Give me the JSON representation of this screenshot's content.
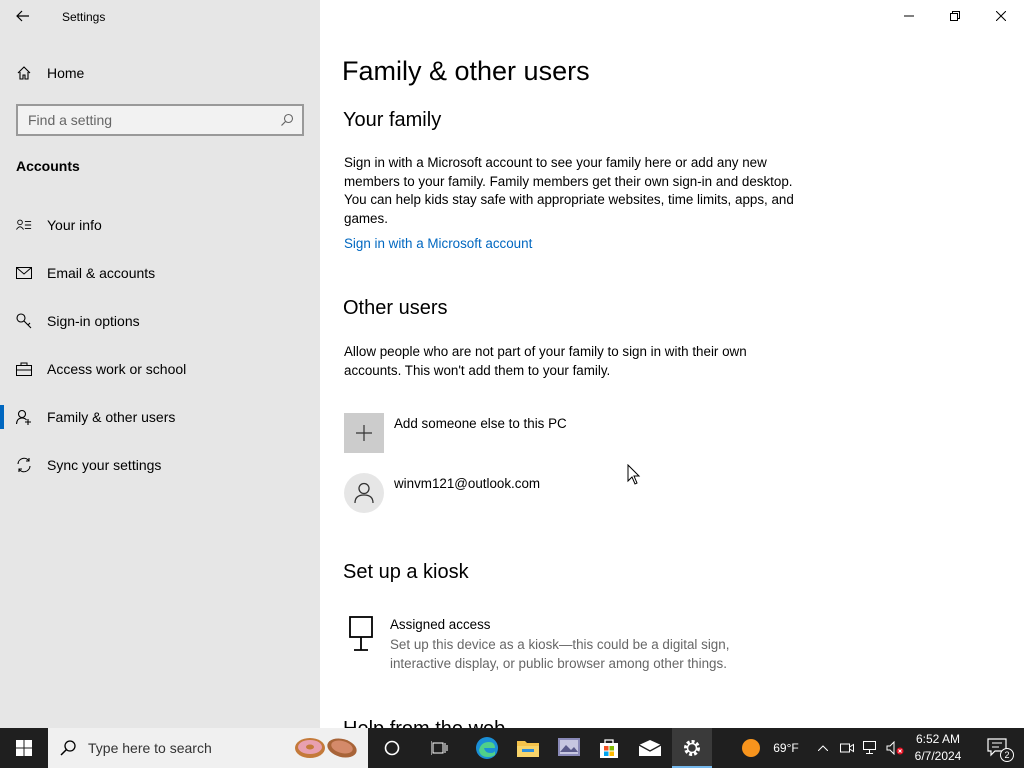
{
  "window": {
    "app_title": "Settings",
    "controls": [
      "minimize",
      "restore",
      "close"
    ]
  },
  "sidebar": {
    "home_label": "Home",
    "search_placeholder": "Find a setting",
    "section_title": "Accounts",
    "items": [
      {
        "label": "Your info",
        "icon": "person-card-icon",
        "active": false
      },
      {
        "label": "Email & accounts",
        "icon": "mail-icon",
        "active": false
      },
      {
        "label": "Sign-in options",
        "icon": "key-icon",
        "active": false
      },
      {
        "label": "Access work or school",
        "icon": "briefcase-icon",
        "active": false
      },
      {
        "label": "Family & other users",
        "icon": "person-add-icon",
        "active": true
      },
      {
        "label": "Sync your settings",
        "icon": "sync-icon",
        "active": false
      }
    ]
  },
  "main": {
    "page_title": "Family & other users",
    "family": {
      "heading": "Your family",
      "description": "Sign in with a Microsoft account to see your family here or add any new members to your family. Family members get their own sign-in and desktop. You can help kids stay safe with appropriate websites, time limits, apps, and games.",
      "link": "Sign in with a Microsoft account"
    },
    "other_users": {
      "heading": "Other users",
      "description": "Allow people who are not part of your family to sign in with their own accounts. This won't add them to your family.",
      "add_label": "Add someone else to this PC",
      "users": [
        "winvm121@outlook.com"
      ]
    },
    "kiosk": {
      "heading": "Set up a kiosk",
      "title": "Assigned access",
      "description": "Set up this device as a kiosk—this could be a digital sign, interactive display, or public browser among other things."
    },
    "next_heading_partial": "Help from the web"
  },
  "taskbar": {
    "search_placeholder": "Type here to search",
    "weather": "69°F",
    "time": "6:52 AM",
    "date": "6/7/2024",
    "notification_count": "2",
    "accent_color": "#0067c0"
  }
}
